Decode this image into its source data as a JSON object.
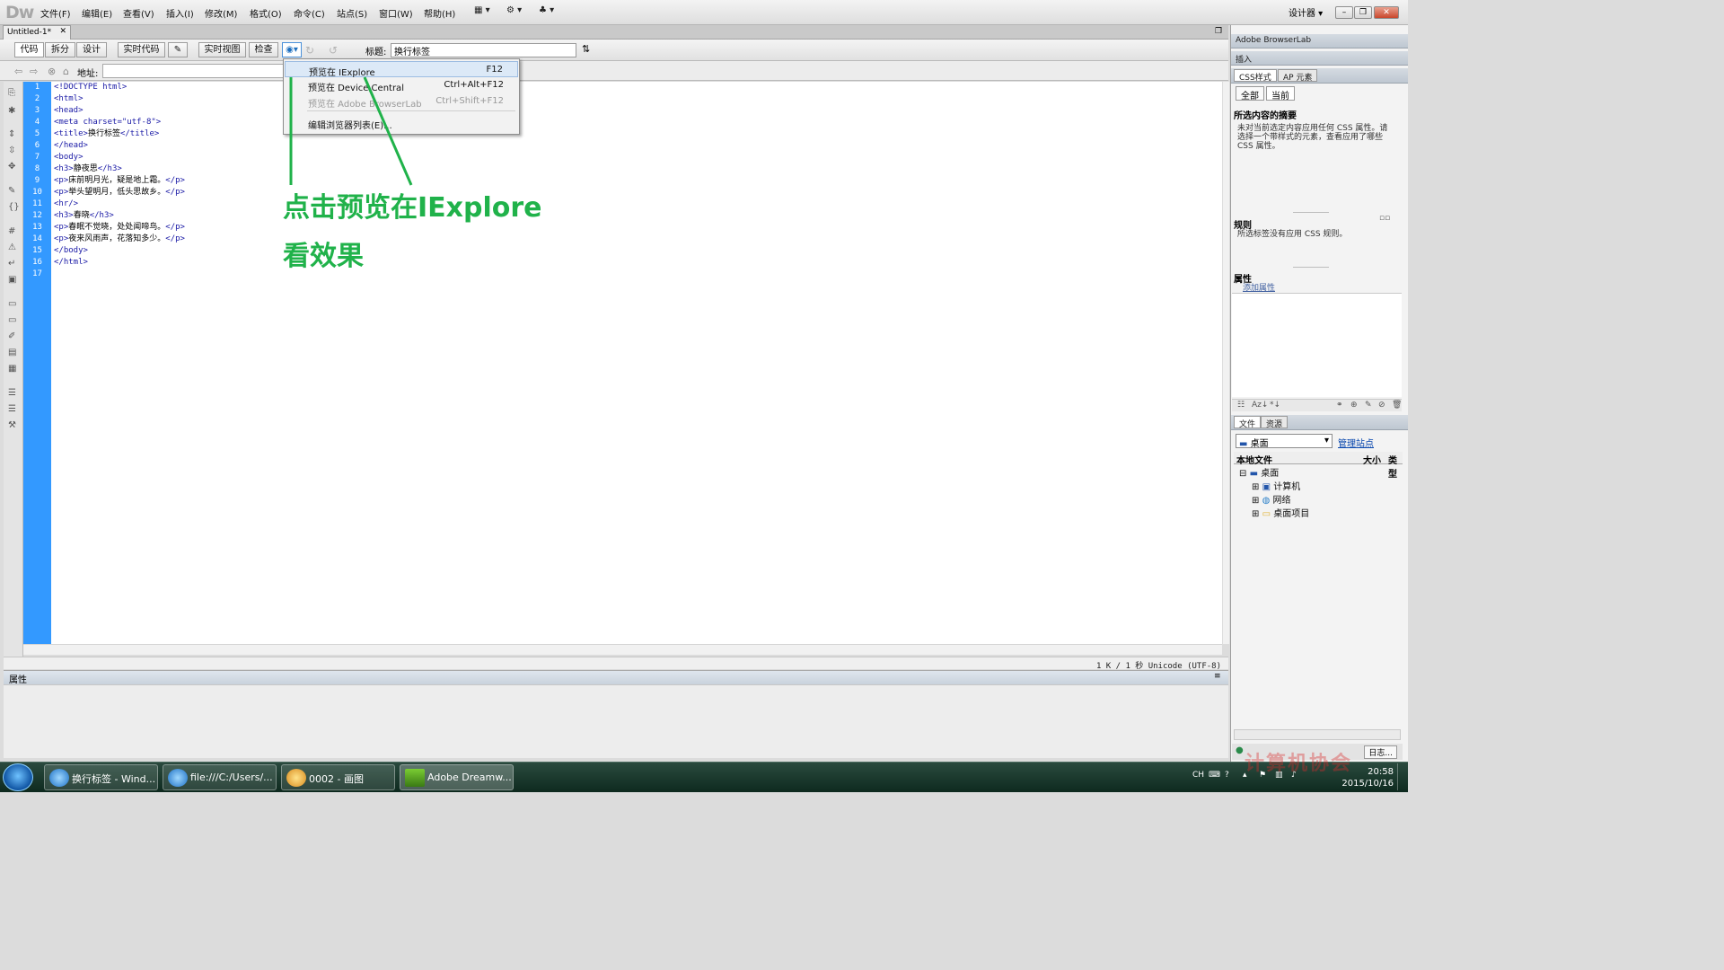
{
  "app": {
    "logo": "Dw",
    "menus": [
      "文件(F)",
      "编辑(E)",
      "查看(V)",
      "插入(I)",
      "修改(M)",
      "格式(O)",
      "命令(C)",
      "站点(S)",
      "窗口(W)",
      "帮助(H)"
    ],
    "workspace": "设计器"
  },
  "document": {
    "tab_label": "Untitled-1*",
    "view_buttons": {
      "code": "代码",
      "split": "拆分",
      "design": "设计",
      "live_code": "实时代码",
      "live_view": "实时视图",
      "inspect": "检查"
    },
    "title_label": "标题:",
    "title_value": "换行标签",
    "address_label": "地址:"
  },
  "preview_menu": {
    "items": [
      {
        "label": "预览在 IExplore",
        "shortcut": "F12",
        "state": "highlighted"
      },
      {
        "label": "预览在 Device Central",
        "shortcut": "Ctrl+Alt+F12",
        "state": "normal"
      },
      {
        "label": "预览在 Adobe BrowserLab",
        "shortcut": "Ctrl+Shift+F12",
        "state": "disabled"
      },
      {
        "label": "编辑浏览器列表(E)...",
        "shortcut": "",
        "state": "normal"
      }
    ]
  },
  "annotation": {
    "line1": "点击预览在IExplore",
    "line2": "看效果",
    "color": "#20b24a"
  },
  "code": {
    "line_numbers": [
      "1",
      "2",
      "3",
      "4",
      "5",
      "6",
      "7",
      "8",
      "9",
      "10",
      "11",
      "12",
      "13",
      "14",
      "15",
      "16",
      "17"
    ],
    "lines": [
      [
        {
          "c": "tag",
          "t": "<!DOCTYPE html>"
        }
      ],
      [
        {
          "c": "tag",
          "t": "<html>"
        }
      ],
      [
        {
          "c": "tag",
          "t": "<head>"
        }
      ],
      [
        {
          "c": "tag",
          "t": "<meta charset=\"utf-8\">"
        }
      ],
      [
        {
          "c": "tag",
          "t": "<title>"
        },
        {
          "c": "text",
          "t": "换行标签"
        },
        {
          "c": "tag",
          "t": "</title>"
        }
      ],
      [
        {
          "c": "tag",
          "t": "</head>"
        }
      ],
      [
        {
          "c": "tag",
          "t": "<body>"
        }
      ],
      [
        {
          "c": "tag",
          "t": "<h3>"
        },
        {
          "c": "text",
          "t": "静夜思"
        },
        {
          "c": "tag",
          "t": "</h3>"
        }
      ],
      [
        {
          "c": "tag",
          "t": "<p>"
        },
        {
          "c": "text",
          "t": "床前明月光，疑是地上霜。"
        },
        {
          "c": "tag",
          "t": "</p>"
        }
      ],
      [
        {
          "c": "tag",
          "t": "<p>"
        },
        {
          "c": "text",
          "t": "举头望明月，低头思故乡。"
        },
        {
          "c": "tag",
          "t": "</p>"
        }
      ],
      [
        {
          "c": "tag",
          "t": "<hr/>"
        }
      ],
      [
        {
          "c": "tag",
          "t": "<h3>"
        },
        {
          "c": "text",
          "t": "春晓"
        },
        {
          "c": "tag",
          "t": "</h3>"
        }
      ],
      [
        {
          "c": "tag",
          "t": "<p>"
        },
        {
          "c": "text",
          "t": "春眠不觉晓，处处闻啼鸟。"
        },
        {
          "c": "tag",
          "t": "</p>"
        }
      ],
      [
        {
          "c": "tag",
          "t": "<p>"
        },
        {
          "c": "text",
          "t": "夜来风雨声，花落知多少。"
        },
        {
          "c": "tag",
          "t": "</p>"
        }
      ],
      [
        {
          "c": "tag",
          "t": "</body>"
        }
      ],
      [
        {
          "c": "tag",
          "t": "</html>"
        }
      ],
      []
    ],
    "tag_color": "#1a1aa6",
    "gutter_color": "#3399ff"
  },
  "status": {
    "text": "1 K / 1 秒 Unicode (UTF-8)"
  },
  "properties_panel": {
    "title": "属性"
  },
  "right_panel": {
    "browserlab": "Adobe BrowserLab",
    "insert": "插入",
    "css_tab": "CSS样式",
    "ap_tab": "AP 元素",
    "all_btn": "全部",
    "current_btn": "当前",
    "summary_title": "所选内容的摘要",
    "summary_text": "未对当前选定内容应用任何 CSS 属性。请选择一个带样式的元素，查看应用了哪些 CSS 属性。",
    "rules_title": "规则",
    "rules_text": "所选标签没有应用 CSS 规则。",
    "props_title": "属性",
    "add_property": "添加属性",
    "files_tab": "文件",
    "assets_tab": "资源",
    "site_select": "桌面",
    "manage_sites": "管理站点",
    "local_files": "本地文件",
    "size_col": "大小",
    "type_col": "类型",
    "tree": [
      {
        "label": "桌面",
        "level": 0,
        "icon": "desktop-icon"
      },
      {
        "label": "计算机",
        "level": 1,
        "icon": "computer-icon"
      },
      {
        "label": "网络",
        "level": 1,
        "icon": "network-icon"
      },
      {
        "label": "桌面项目",
        "level": 1,
        "icon": "folder-icon"
      }
    ],
    "log_btn": "日志..."
  },
  "taskbar": {
    "items": [
      {
        "label": "换行标签 - Wind...",
        "icon": "ie-icon"
      },
      {
        "label": "file:///C:/Users/...",
        "icon": "ie-icon"
      },
      {
        "label": "0002 - 画图",
        "icon": "paint-icon"
      },
      {
        "label": "Adobe Dreamw...",
        "icon": "dreamweaver-icon"
      }
    ],
    "lang": "CH",
    "time": "20:58",
    "date": "2015/10/16"
  },
  "watermark": "计算机协会"
}
